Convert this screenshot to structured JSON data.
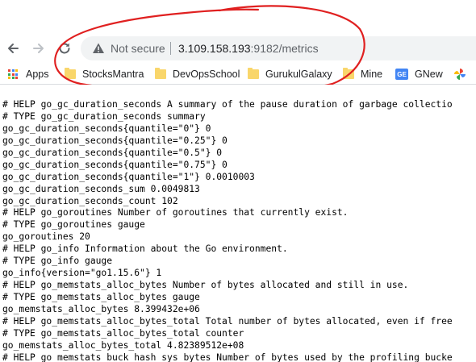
{
  "toolbar": {
    "security_label": "Not secure",
    "url_host": "3.109.158.193",
    "url_path": ":9182/metrics"
  },
  "bookmarks": [
    {
      "label": "Apps",
      "icon": "apps-grid-icon"
    },
    {
      "label": "StocksMantra",
      "icon": "folder-icon"
    },
    {
      "label": "DevOpsSchool",
      "icon": "folder-icon"
    },
    {
      "label": "GurukulGalaxy",
      "icon": "folder-icon"
    },
    {
      "label": "Mine",
      "icon": "folder-icon"
    },
    {
      "label": "GNew",
      "icon": "google-news-icon"
    }
  ],
  "colors": {
    "annotation": "#e02020",
    "folder": "#f9d66b",
    "warning": "#5f6368"
  },
  "metrics_lines": [
    "# HELP go_gc_duration_seconds A summary of the pause duration of garbage collectio",
    "# TYPE go_gc_duration_seconds summary",
    "go_gc_duration_seconds{quantile=\"0\"} 0",
    "go_gc_duration_seconds{quantile=\"0.25\"} 0",
    "go_gc_duration_seconds{quantile=\"0.5\"} 0",
    "go_gc_duration_seconds{quantile=\"0.75\"} 0",
    "go_gc_duration_seconds{quantile=\"1\"} 0.0010003",
    "go_gc_duration_seconds_sum 0.0049813",
    "go_gc_duration_seconds_count 102",
    "# HELP go_goroutines Number of goroutines that currently exist.",
    "# TYPE go_goroutines gauge",
    "go_goroutines 20",
    "# HELP go_info Information about the Go environment.",
    "# TYPE go_info gauge",
    "go_info{version=\"go1.15.6\"} 1",
    "# HELP go_memstats_alloc_bytes Number of bytes allocated and still in use.",
    "# TYPE go_memstats_alloc_bytes gauge",
    "go_memstats_alloc_bytes 8.399432e+06",
    "# HELP go_memstats_alloc_bytes_total Total number of bytes allocated, even if free",
    "# TYPE go_memstats_alloc_bytes_total counter",
    "go_memstats_alloc_bytes_total 4.82389512e+08",
    "# HELP go_memstats_buck_hash_sys_bytes Number of bytes used by the profiling bucke"
  ]
}
